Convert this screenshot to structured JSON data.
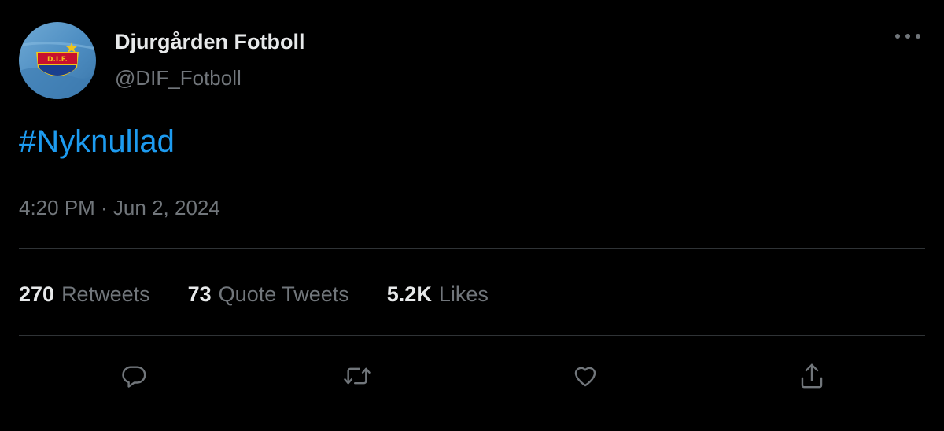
{
  "tweet": {
    "author": {
      "display_name": "Djurgården Fotboll",
      "handle": "@DIF_Fotboll",
      "avatar_icon": "dif-crest-logo",
      "avatar_text": "D.I.F."
    },
    "text": "#Nyknullad",
    "timestamp": "4:20 PM · Jun 2, 2024",
    "stats": [
      {
        "count": "270",
        "label": "Retweets"
      },
      {
        "count": "73",
        "label": "Quote Tweets"
      },
      {
        "count": "5.2K",
        "label": "Likes"
      }
    ],
    "actions": [
      {
        "name": "reply",
        "icon": "reply-icon"
      },
      {
        "name": "retweet",
        "icon": "retweet-icon"
      },
      {
        "name": "like",
        "icon": "heart-icon"
      },
      {
        "name": "share",
        "icon": "share-icon"
      }
    ],
    "more_icon": "more-horizontal-icon"
  },
  "colors": {
    "background": "#000000",
    "text_primary": "#e7e9ea",
    "text_secondary": "#71767b",
    "link": "#1d9bf0",
    "divider": "#2f3336"
  }
}
